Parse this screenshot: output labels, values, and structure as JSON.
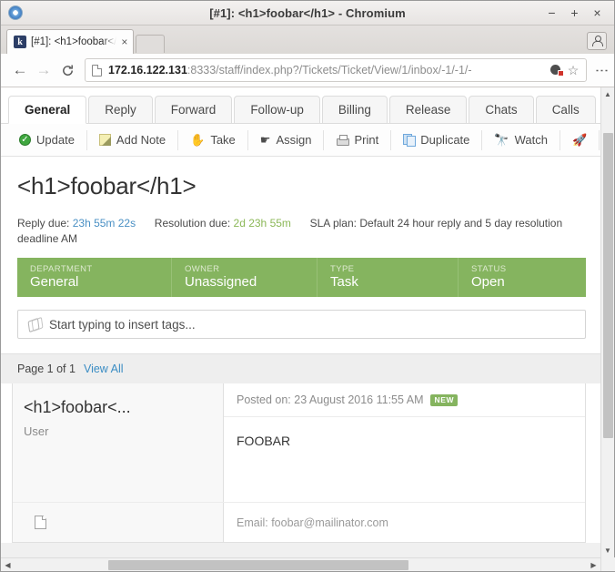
{
  "window": {
    "title": "[#1]: <h1>foobar</h1> - Chromium",
    "minimize": "−",
    "maximize": "+",
    "close": "×"
  },
  "browser": {
    "tab": {
      "favicon_letter": "k",
      "title": "[#1]: <h1>foobar</",
      "close": "×"
    },
    "nav": {
      "back": "←",
      "forward": "→",
      "reload": "C"
    },
    "omnibox": {
      "host": "172.16.122.131",
      "rest": ":8333/staff/index.php?/Tickets/Ticket/View/1/inbox/-1/-1/-",
      "full_url": "172.16.122.131:8333/staff/index.php?/Tickets/Ticket/View/1/inbox/-1/-1/-",
      "star": "☆",
      "menu": "⋮"
    }
  },
  "app": {
    "tabs": [
      {
        "label": "General",
        "active": true
      },
      {
        "label": "Reply",
        "active": false
      },
      {
        "label": "Forward",
        "active": false
      },
      {
        "label": "Follow-up",
        "active": false
      },
      {
        "label": "Billing",
        "active": false
      },
      {
        "label": "Release",
        "active": false
      },
      {
        "label": "Chats",
        "active": false
      },
      {
        "label": "Calls",
        "active": false
      }
    ],
    "actions": [
      {
        "label": "Update",
        "icon": "check-circle-icon"
      },
      {
        "label": "Add Note",
        "icon": "note-icon"
      },
      {
        "label": "Take",
        "icon": "hand-icon",
        "glyph": "✋"
      },
      {
        "label": "Assign",
        "icon": "pointing-finger-icon",
        "glyph": "☛"
      },
      {
        "label": "Print",
        "icon": "printer-icon"
      },
      {
        "label": "Duplicate",
        "icon": "copy-icon"
      },
      {
        "label": "Watch",
        "icon": "binoculars-icon",
        "glyph": "🔭"
      },
      {
        "label": "",
        "icon": "escalate-rocket-icon",
        "glyph": "🚀"
      }
    ],
    "ticket": {
      "title": "<h1>foobar</h1>",
      "reply_due_label": "Reply due:",
      "reply_due_value": "23h 55m 22s",
      "resolution_due_label": "Resolution due:",
      "resolution_due_value": "2d 23h 55m",
      "sla_label": "SLA plan:",
      "sla_value": "Default 24 hour reply and 5 day resolution deadline",
      "sla_overflow": "AM",
      "info": [
        {
          "key": "DEPARTMENT",
          "value": "General"
        },
        {
          "key": "OWNER",
          "value": "Unassigned"
        },
        {
          "key": "TYPE",
          "value": "Task"
        },
        {
          "key": "STATUS",
          "value": "Open"
        }
      ],
      "tags_placeholder": "Start typing to insert tags..."
    },
    "paging": {
      "label": "Page 1 of 1",
      "view_all": "View All"
    },
    "thread": {
      "author_name": "<h1>foobar<...",
      "author_role": "User",
      "posted_label": "Posted on: 23 August 2016 11:55 AM",
      "badge": "NEW",
      "body": "FOOBAR",
      "email": "Email: foobar@mailinator.com"
    }
  },
  "colors": {
    "brand_green": "#85b45f",
    "link_blue": "#3b8dc4",
    "due_blue": "#4a90c4",
    "due_green": "#8cb858"
  },
  "scrollbars": {
    "up_arrow": "▲",
    "down_arrow": "▼",
    "left_arrow": "◀",
    "right_arrow": "▶"
  }
}
